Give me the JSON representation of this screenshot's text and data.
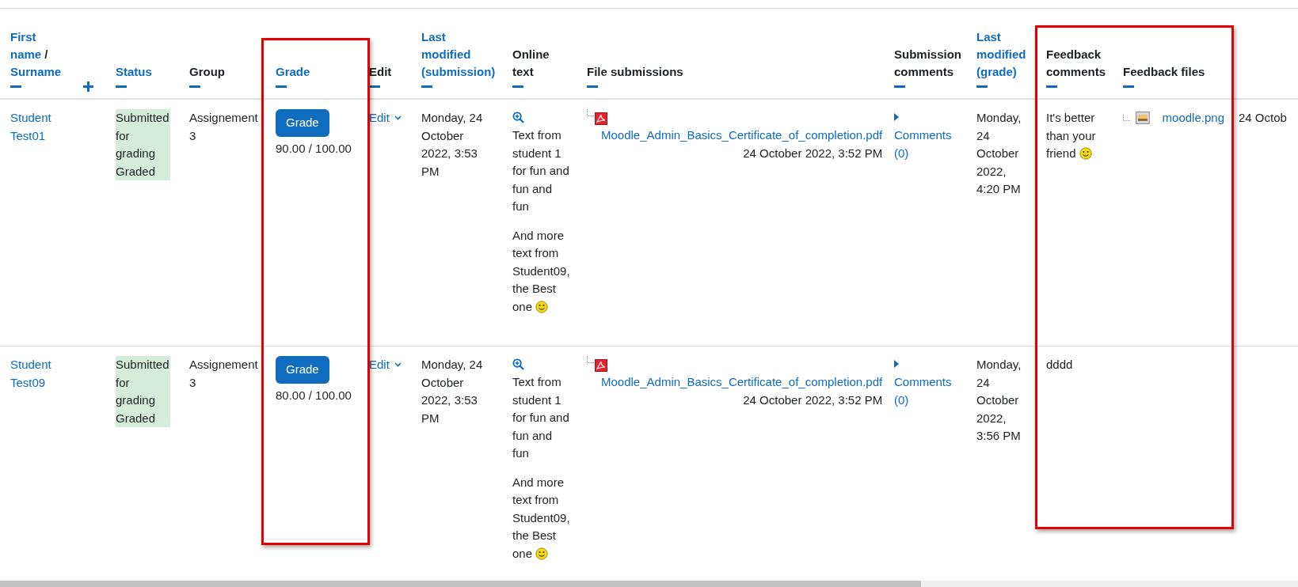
{
  "columns": [
    {
      "parts": [
        {
          "text": "First name",
          "sortable": true
        },
        {
          "text": "/",
          "sortable": false
        },
        {
          "text": "Surname",
          "sortable": true
        }
      ],
      "hidden": false
    },
    {
      "hidden": true
    },
    {
      "parts": [
        {
          "text": "Status",
          "sortable": true
        }
      ],
      "hidden": false
    },
    {
      "parts": [
        {
          "text": "Group",
          "sortable": false
        }
      ],
      "hidden": false
    },
    {
      "parts": [
        {
          "text": "Grade",
          "sortable": true
        }
      ],
      "hidden": false
    },
    {
      "parts": [
        {
          "text": "Edit",
          "sortable": false
        }
      ],
      "hidden": false
    },
    {
      "parts": [
        {
          "text": "Last modified (submission)",
          "sortable": true
        }
      ],
      "hidden": false
    },
    {
      "parts": [
        {
          "text": "Online text",
          "sortable": false
        }
      ],
      "hidden": false
    },
    {
      "parts": [
        {
          "text": "File submissions",
          "sortable": false
        }
      ],
      "hidden": false
    },
    {
      "parts": [
        {
          "text": "Submission comments",
          "sortable": false
        }
      ],
      "hidden": false
    },
    {
      "parts": [
        {
          "text": "Last modified (grade)",
          "sortable": true
        }
      ],
      "hidden": false
    },
    {
      "parts": [
        {
          "text": "Feedback comments",
          "sortable": false
        }
      ],
      "hidden": false
    },
    {
      "parts": [
        {
          "text": "Feedback files",
          "sortable": false
        }
      ],
      "hidden": false
    }
  ],
  "rows": [
    {
      "name": "Student Test01",
      "status": [
        "Submitted for grading",
        "Graded"
      ],
      "group": "Assignement 3",
      "grade_button": "Grade",
      "grade": "90.00 / 100.00",
      "edit": "Edit",
      "last_modified_submission": "Monday, 24 October 2022, 3:53 PM",
      "online_text": [
        {
          "text": "Text from student 1 for fun and fun and fun",
          "smiley": false
        },
        {
          "text": "And more text from Student09, the Best one",
          "smiley": true
        }
      ],
      "file": {
        "name": "Moodle_Admin_Basics_Certificate_of_completion.pdf",
        "date": "24 October 2022, 3:52 PM"
      },
      "comments": "Comments (0)",
      "last_modified_grade": "Monday, 24 October 2022, 4:20 PM",
      "feedback_comment": {
        "text": "It's better than your friend",
        "smiley": true
      },
      "feedback_files": [
        "moodle.png"
      ],
      "column_14": "24 Octob"
    },
    {
      "name": "Student Test09",
      "status": [
        "Submitted for grading",
        "Graded"
      ],
      "group": "Assignement 3",
      "grade_button": "Grade",
      "grade": "80.00 / 100.00",
      "edit": "Edit",
      "last_modified_submission": "Monday, 24 October 2022, 3:53 PM",
      "online_text": [
        {
          "text": "Text from student 1 for fun and fun and fun",
          "smiley": false
        },
        {
          "text": "And more text from Student09, the Best one",
          "smiley": true
        }
      ],
      "file": {
        "name": "Moodle_Admin_Basics_Certificate_of_completion.pdf",
        "date": "24 October 2022, 3:52 PM"
      },
      "comments": "Comments (0)",
      "last_modified_grade": "Monday, 24 October 2022, 3:56 PM",
      "feedback_comment": {
        "text": "dddd",
        "smiley": false
      }
    }
  ],
  "annotations": [
    {
      "kind": "frame",
      "color": "#e50000"
    },
    {
      "kind": "frame",
      "color": "#e50000"
    }
  ]
}
